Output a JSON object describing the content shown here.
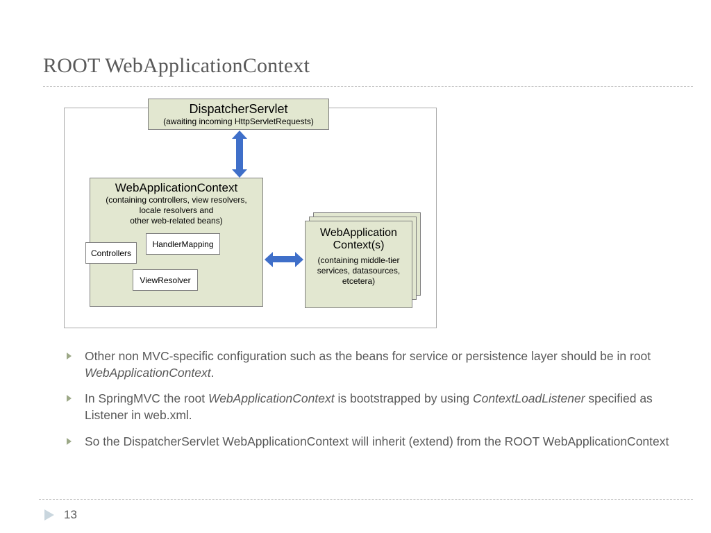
{
  "title": "ROOT WebApplicationContext",
  "pageNumber": "13",
  "diagram": {
    "dispatcher": {
      "title": "DispatcherServlet",
      "sub": "(awaiting incoming HttpServletRequests)"
    },
    "wac": {
      "title": "WebApplicationContext",
      "sub": "(containing controllers, view resolvers,\nlocale resolvers and\nother web-related beans)"
    },
    "innerBoxes": {
      "controllers": "Controllers",
      "handlerMapping": "HandlerMapping",
      "viewResolver": "ViewResolver"
    },
    "stack": {
      "title": "WebApplication\nContext(s)",
      "sub": "(containing middle-tier\nservices, datasources,\netcetera)"
    }
  },
  "bullets": [
    {
      "plain1": "Other non MVC-specific configuration such as the beans for service or persistence layer should be in root ",
      "italic1": "WebApplicationContext",
      "plain2": "."
    },
    {
      "plain1": "In SpringMVC the root ",
      "italic1": "WebApplicationContext",
      "plain2": " is bootstrapped by using ",
      "italic2": "ContextLoadListener",
      "plain3": " specified as Listener in web.xml."
    },
    {
      "plain1": "So the DispatcherServlet WebApplicationContext will inherit (extend) from the ROOT WebApplicationContext"
    }
  ]
}
